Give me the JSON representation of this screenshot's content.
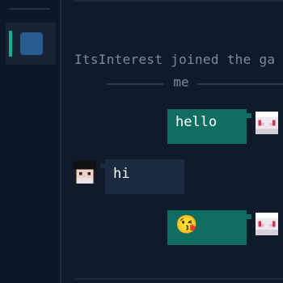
{
  "messages": {
    "system_join": {
      "line1": "ItsInterest joined the ga",
      "line2": "me"
    },
    "hello": {
      "text": "hello"
    },
    "hi": {
      "text": "hi"
    },
    "emoji": {
      "text": "😘"
    }
  },
  "colors": {
    "background": "#0f1a2a",
    "sidebar": "#0c1727",
    "outgoing_bubble": "#0f6e5f",
    "incoming_bubble": "#1c2a40",
    "accent": "#1faa8f",
    "server_icon": "#2a5d8f",
    "system_text": "#7e8a99"
  },
  "icons": {
    "self_avatar": "pixel-avatar-white",
    "other_avatar": "pixel-avatar-dark-hair",
    "server": "server-icon"
  }
}
